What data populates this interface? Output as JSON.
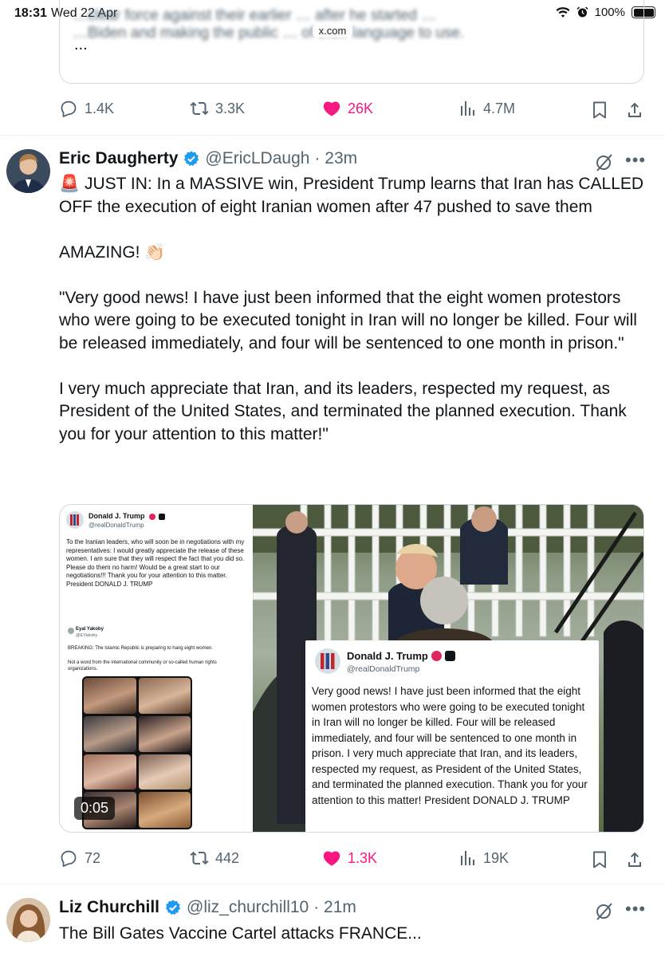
{
  "status_bar": {
    "time": "18:31",
    "date": "Wed 22 Apr",
    "url": "x.com",
    "battery": "100%"
  },
  "prev_tweet": {
    "quote_blur_line1": "…clear force against their earlier … after he started …",
    "quote_blur_line2": "…Biden and making the public … of their language to use.",
    "quote_ellipsis": "...",
    "actions": {
      "replies": "1.4K",
      "reposts": "3.3K",
      "likes": "26K",
      "views": "4.7M"
    }
  },
  "tweet1": {
    "name": "Eric Daugherty",
    "handle": "@EricLDaugh",
    "time": "· 23m",
    "text": "🚨 JUST IN: In a MASSIVE win, President Trump learns that Iran has CALLED OFF the execution of eight Iranian women after 47 pushed to save them\n\nAMAZING! 👏🏻\n\n\"Very good news! I have just been informed that the eight women protestors who were going to be executed tonight in Iran will no longer be killed. Four will be released immediately, and four will be sentenced to one month in prison.\"\n\nI very much appreciate that Iran, and its leaders, respected my request, as President of the United States, and terminated the planned execution. Thank you for your attention to this matter!\"",
    "media": {
      "left_name": "Donald J. Trump",
      "left_handle": "@realDonaldTrump",
      "left_text": "To the Iranian leaders, who will soon be in negotiations with my representatives: I would greatly appreciate the release of these women. I am sure that they will respect the fact that you did so. Please do them no harm! Would be a great start to our negotiations!!! Thank you for your attention to this matter. President DONALD J. TRUMP",
      "embed_name": "Eyal Yakoby",
      "embed_handle": "@EYakoby",
      "embed_text1": "BREAKING: The Islamic Republic is preparing to hang eight women.",
      "embed_text2": "Not a word from the international community or so-called human rights organizations.",
      "duration": "0:05",
      "card_name": "Donald J. Trump",
      "card_handle": "@realDonaldTrump",
      "card_text": "Very good news! I have just been informed that the eight women protestors who were going to be executed tonight in Iran will no longer be killed. Four will be released immediately, and four will be sentenced to one month in prison. I very much appreciate that Iran, and its leaders, respected my request, as President of the United States, and terminated the planned execution. Thank you for your attention to this matter! President DONALD J. TRUMP"
    },
    "actions": {
      "replies": "72",
      "reposts": "442",
      "likes": "1.3K",
      "views": "19K"
    }
  },
  "tweet2": {
    "name": "Liz Churchill",
    "handle": "@liz_churchill10",
    "time": "· 21m",
    "text": "The Bill Gates Vaccine Cartel attacks FRANCE..."
  },
  "colors": {
    "like": "#f91880",
    "verified": "#1d9bf0",
    "muted": "#536471"
  }
}
